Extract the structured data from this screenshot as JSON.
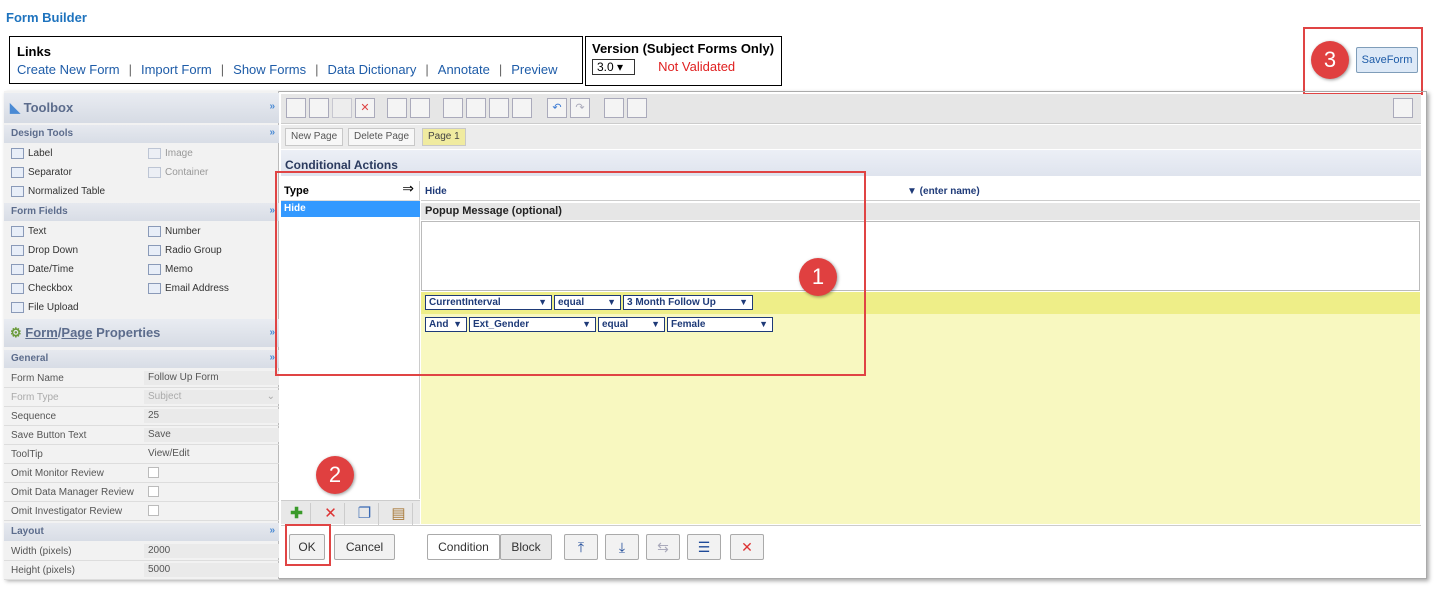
{
  "app": {
    "title": "Form Builder"
  },
  "links": {
    "heading": "Links",
    "items": [
      "Create New Form",
      "Import Form",
      "Show Forms",
      "Data Dictionary",
      "Annotate",
      "Preview"
    ],
    "separator": "|"
  },
  "version": {
    "heading": "Version (Subject Forms Only)",
    "selected": "3.0",
    "status": "Not Validated",
    "status_color": "#e02020"
  },
  "save_form_label": "SaveForm",
  "badges": {
    "one": "1",
    "two": "2",
    "three": "3"
  },
  "toolbox": {
    "title": "Toolbox",
    "design_tools": {
      "label": "Design Tools",
      "items": [
        {
          "label": "Label",
          "icon": "label-icon",
          "enabled": true
        },
        {
          "label": "Image",
          "icon": "image-icon",
          "enabled": false
        },
        {
          "label": "Separator",
          "icon": "separator-icon",
          "enabled": true
        },
        {
          "label": "Container",
          "icon": "container-icon",
          "enabled": false
        },
        {
          "label": "Normalized Table",
          "icon": "table-icon",
          "enabled": true
        }
      ]
    },
    "form_fields": {
      "label": "Form Fields",
      "items": [
        {
          "label": "Text",
          "icon": "text-field-icon"
        },
        {
          "label": "Number",
          "icon": "number-icon"
        },
        {
          "label": "Drop Down",
          "icon": "dropdown-icon"
        },
        {
          "label": "Radio Group",
          "icon": "radio-group-icon"
        },
        {
          "label": "Date/Time",
          "icon": "datetime-icon"
        },
        {
          "label": "Memo",
          "icon": "memo-icon"
        },
        {
          "label": "Checkbox",
          "icon": "checkbox-icon"
        },
        {
          "label": "Email Address",
          "icon": "email-icon"
        },
        {
          "label": "File Upload",
          "icon": "file-upload-icon"
        }
      ]
    }
  },
  "properties": {
    "title_form": "Form",
    "title_sep": "/",
    "title_page": "Page",
    "title_rest": "Properties",
    "general_label": "General",
    "general": [
      {
        "name": "Form Name",
        "value": "Follow Up Form"
      },
      {
        "name": "Form Type",
        "value": "Subject"
      },
      {
        "name": "Sequence",
        "value": "25"
      },
      {
        "name": "Save Button Text",
        "value": "Save"
      },
      {
        "name": "ToolTip",
        "value": "View/Edit"
      },
      {
        "name": "Omit Monitor Review",
        "value": ""
      },
      {
        "name": "Omit Data Manager Review",
        "value": ""
      },
      {
        "name": "Omit Investigator Review",
        "value": ""
      }
    ],
    "layout_label": "Layout",
    "layout": [
      {
        "name": "Width (pixels)",
        "value": "2000"
      },
      {
        "name": "Height (pixels)",
        "value": "5000"
      }
    ]
  },
  "page_bar": {
    "new_page": "New Page",
    "delete_page": "Delete Page",
    "current_page": "Page 1"
  },
  "conditional": {
    "title": "Conditional Actions",
    "type_header": "Type",
    "type_arrow": "⇒",
    "type_items": [
      "Hide"
    ],
    "action": "Hide",
    "action_name": "▼ (enter name)",
    "popup_label": "Popup Message (optional)",
    "popup_value": "",
    "conditions": [
      {
        "field": "CurrentInterval",
        "operator": "equal",
        "value": "3 Month Follow Up"
      },
      {
        "conjunction": "And",
        "field": "Ext_Gender",
        "operator": "equal",
        "value": "Female"
      }
    ]
  },
  "buttons": {
    "ok": "OK",
    "cancel": "Cancel",
    "condition": "Condition",
    "block": "Block"
  }
}
